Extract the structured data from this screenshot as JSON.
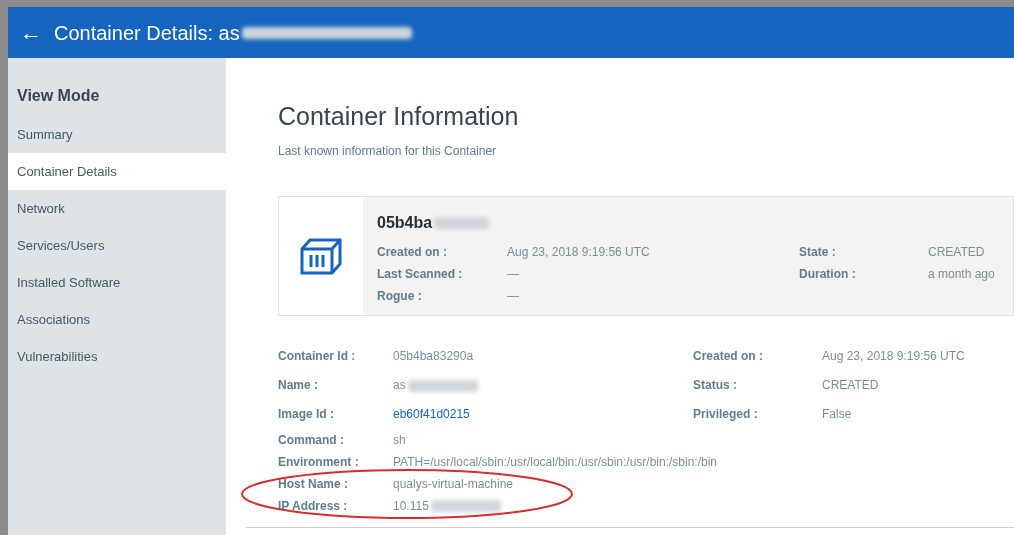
{
  "header": {
    "back_icon": "←",
    "title": "Container Details: as",
    "title_redacted": true
  },
  "sidebar": {
    "heading": "View Mode",
    "items": [
      {
        "label": "Summary",
        "selected": false
      },
      {
        "label": "Container Details",
        "selected": true
      },
      {
        "label": "Network",
        "selected": false
      },
      {
        "label": "Services/Users",
        "selected": false
      },
      {
        "label": "Installed Software",
        "selected": false
      },
      {
        "label": "Associations",
        "selected": false
      },
      {
        "label": "Vulnerabilities",
        "selected": false
      }
    ]
  },
  "section": {
    "title": "Container Information",
    "subtitle": "Last known information for this Container"
  },
  "card": {
    "name": "05b4ba",
    "name_redacted": true,
    "left": [
      {
        "label": "Created on :",
        "value": "Aug 23, 2018 9:19:56 UTC"
      },
      {
        "label": "Last Scanned :",
        "value": "—"
      },
      {
        "label": "Rogue :",
        "value": "—"
      }
    ],
    "right": [
      {
        "label": "State :",
        "value": "CREATED"
      },
      {
        "label": "Duration :",
        "value": "a month ago"
      }
    ]
  },
  "details": [
    {
      "label": "Container Id :",
      "value": "05b4ba83290a",
      "kind": "text",
      "redacted": false,
      "right_label": "Created on :",
      "right_value": "Aug 23, 2018 9:19:56 UTC"
    },
    {
      "label": "Name :",
      "value": "as",
      "kind": "text",
      "redacted": true,
      "right_label": "Status :",
      "right_value": "CREATED"
    },
    {
      "label": "Image Id :",
      "value": "eb60f41d0215",
      "kind": "link",
      "redacted": false,
      "right_label": "Privileged :",
      "right_value": "False"
    },
    {
      "label": "Command :",
      "value": "sh",
      "kind": "text",
      "redacted": false
    },
    {
      "label": "Environment :",
      "value": "PATH=/usr/local/sbin:/usr/local/bin:/usr/sbin:/usr/bin:/sbin:/bin",
      "kind": "text",
      "redacted": false
    },
    {
      "label": "Host Name :",
      "value": "qualys-virtual-machine",
      "kind": "text",
      "redacted": false
    },
    {
      "label": "IP Address :",
      "value": "10.115",
      "kind": "text",
      "redacted": true
    }
  ]
}
